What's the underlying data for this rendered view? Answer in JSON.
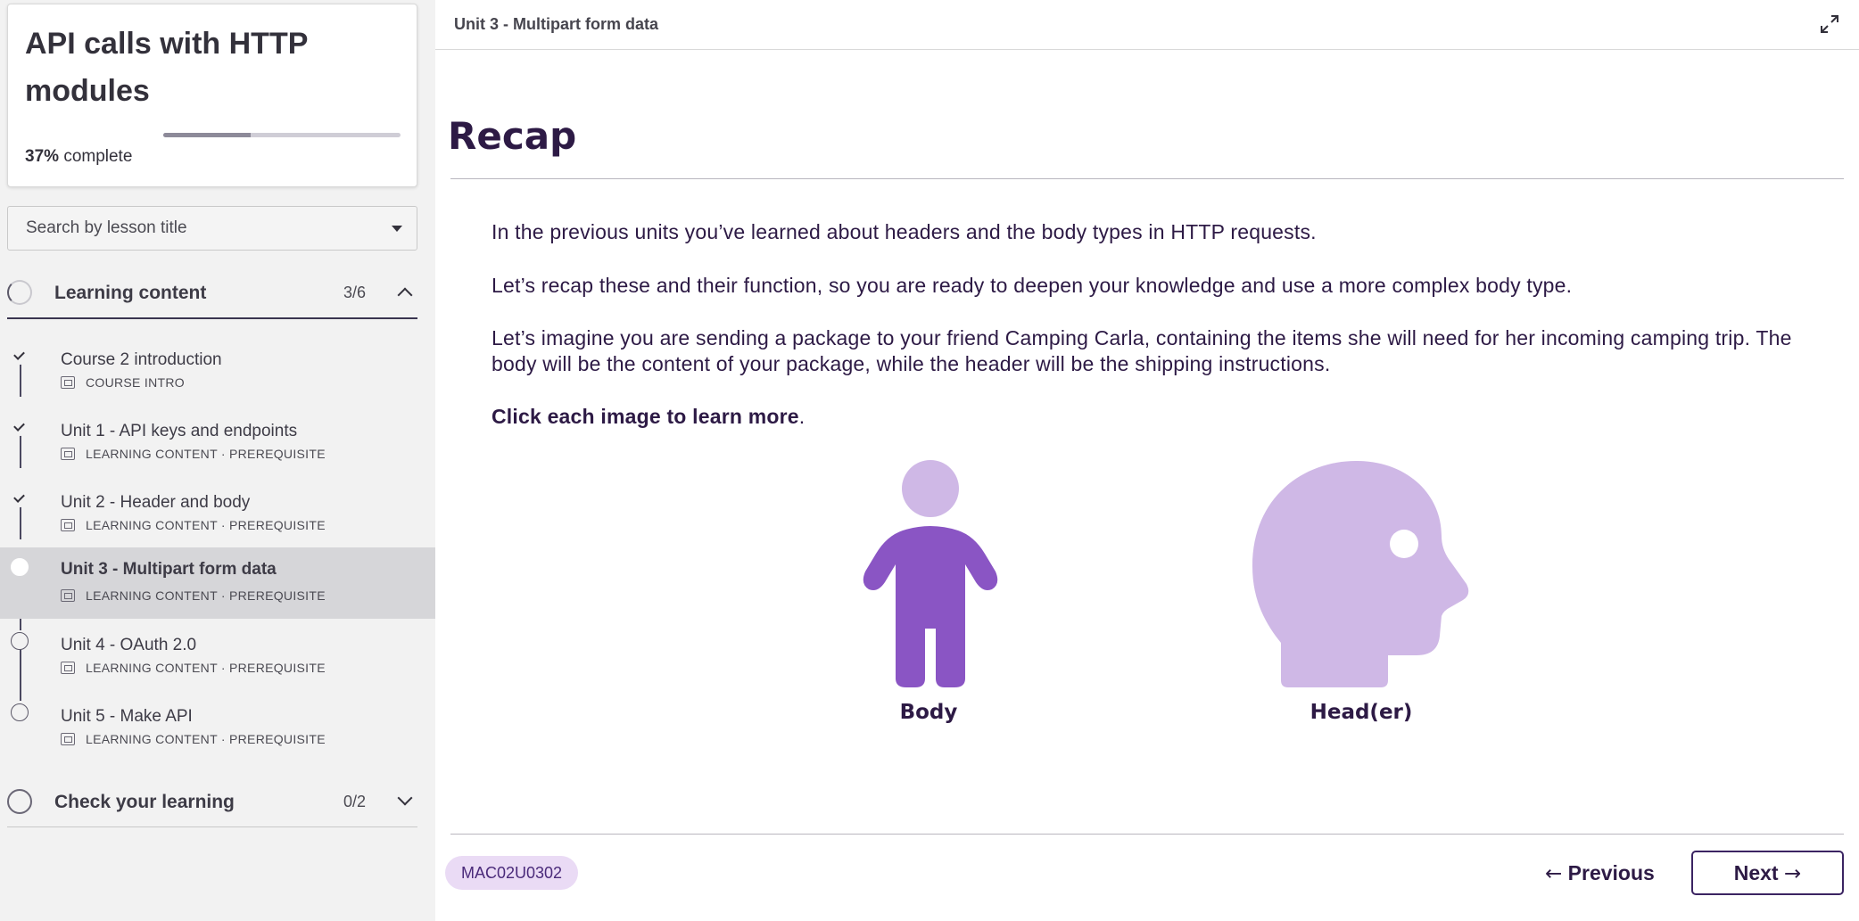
{
  "course": {
    "title": "API calls with HTTP modules",
    "progress_percent": "37%",
    "progress_fraction": 0.37,
    "progress_suffix": "complete"
  },
  "search": {
    "placeholder": "Search by lesson title"
  },
  "sections": [
    {
      "title": "Learning content",
      "count": "3/6",
      "expanded": true,
      "lessons": [
        {
          "title": "Course 2 introduction",
          "meta": "COURSE INTRO",
          "status": "done"
        },
        {
          "title": "Unit 1 - API keys and endpoints",
          "meta": "LEARNING CONTENT · PREREQUISITE",
          "status": "done"
        },
        {
          "title": "Unit 2 - Header and body",
          "meta": "LEARNING CONTENT · PREREQUISITE",
          "status": "done"
        },
        {
          "title": "Unit 3 - Multipart form data",
          "meta": "LEARNING CONTENT · PREREQUISITE",
          "status": "current"
        },
        {
          "title": "Unit 4 - OAuth 2.0",
          "meta": "LEARNING CONTENT · PREREQUISITE",
          "status": "todo"
        },
        {
          "title": "Unit 5 - Make API",
          "meta": "LEARNING CONTENT · PREREQUISITE",
          "status": "todo"
        }
      ]
    },
    {
      "title": "Check your learning",
      "count": "0/2",
      "expanded": false
    }
  ],
  "main": {
    "header_title": "Unit 3 - Multipart form data",
    "page_title": "Recap",
    "paragraphs": [
      "In the previous units you’ve learned about headers and the body types in HTTP requests.",
      "Let’s recap these and their function, so you are ready to deepen your knowledge and use a more complex body type.",
      "Let’s imagine you are sending a package to your friend Camping Carla, containing the items she will need for her incoming camping trip. The body will be the content of your package, while the header will be the shipping instructions."
    ],
    "instruction_bold": "Click each image to learn more",
    "instruction_end": ".",
    "figures": [
      {
        "label": "Body",
        "icon": "person-body-icon",
        "color": "#8a55c4",
        "head_color": "#cfb8e6"
      },
      {
        "label": "Head(er)",
        "icon": "head-profile-icon",
        "color": "#cfb8e6",
        "eye_color": "#ffffff"
      }
    ],
    "lesson_code": "MAC02U0302",
    "prev_label": "Previous",
    "next_label": "Next"
  }
}
